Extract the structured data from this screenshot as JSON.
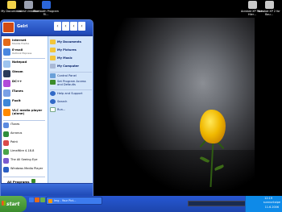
{
  "desktop": {
    "icons": [
      {
        "label": "My Documents",
        "color": "#f2d24a"
      },
      {
        "label": "Latest Unlocker",
        "color": "#9aa0b0"
      },
      {
        "label": "Bluetooth Program Fil...",
        "color": "#2b66d9"
      },
      {
        "label": "Acrobat XP Parts Hier...",
        "color": "#c9c9c9"
      },
      {
        "label": "Acrobat XP 2 for Bau...",
        "color": "#c9c9c9"
      }
    ]
  },
  "start_menu": {
    "user": "Gelri",
    "pinned": [
      {
        "title": "Internet",
        "sub": "Mozilla Firefox",
        "color": "#e46b1a"
      },
      {
        "title": "E-mail",
        "sub": "Outlook Express",
        "color": "#4a87e0"
      }
    ],
    "recent": [
      {
        "label": "Notepad",
        "color": "#9ec4ef"
      },
      {
        "label": "Steam",
        "color": "#2a3a5a"
      },
      {
        "label": "DC++",
        "color": "#b24ad9"
      },
      {
        "label": "iTunes",
        "color": "#7aa0e6"
      },
      {
        "label": "Foxit",
        "color": "#3d87d8"
      },
      {
        "label": "VLC media player (alone)",
        "color": "#ff8a00"
      }
    ],
    "more": [
      {
        "label": "iTunes",
        "color": "#5b8ae0"
      },
      {
        "label": "Acronus",
        "color": "#2f8f3c"
      },
      {
        "label": "Paint",
        "color": "#d94a4a"
      },
      {
        "label": "LimeWire 4.18.8",
        "color": "#4aa54a"
      },
      {
        "label": "The All Seeing Eye",
        "color": "#7a5ad0"
      },
      {
        "label": "Windows Media Player",
        "color": "#2b5fc4"
      }
    ],
    "all_programs": "All Programs",
    "right": [
      {
        "label": "My Documents",
        "color": "#f3c63a"
      },
      {
        "label": "My Pictures",
        "color": "#f3c63a"
      },
      {
        "label": "My Music",
        "color": "#f3c63a"
      },
      {
        "label": "My Computer",
        "color": "#a9b9d6"
      },
      {
        "label": "Control Panel",
        "color": "#6aa0d8"
      },
      {
        "label": "Set Program Access and Defaults",
        "color": "#3b8c2a"
      },
      {
        "label": "Help and Support",
        "color": "#3169c6"
      },
      {
        "label": "Search",
        "color": "#3169c6"
      },
      {
        "label": "Run...",
        "color": "#ffffff"
      }
    ]
  },
  "taskbar": {
    "start_label": "start",
    "task": "Img - Your Pict...",
    "time": "12:19",
    "day": "sunnuntaipe",
    "date": "11.6.2006"
  }
}
